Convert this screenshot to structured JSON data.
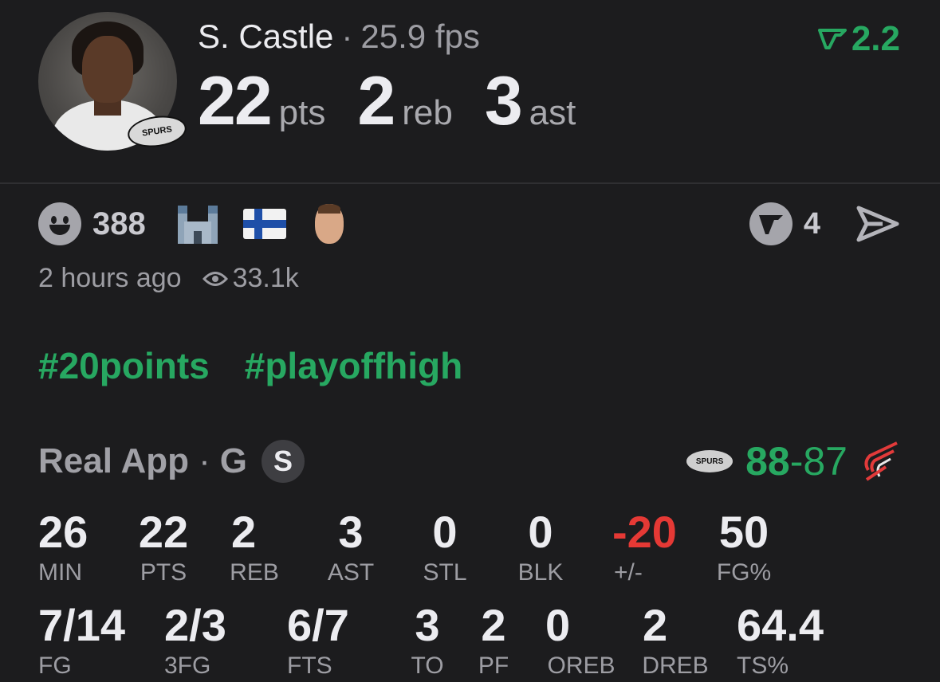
{
  "player": {
    "name": "S. Castle",
    "separator": "·",
    "fps": "25.9 fps",
    "badge_text": "SPURS",
    "stats": [
      {
        "num": "22",
        "unit": "pts"
      },
      {
        "num": "2",
        "unit": "reb"
      },
      {
        "num": "3",
        "unit": "ast"
      }
    ]
  },
  "top_score": {
    "value": "2.2",
    "icon": "real-v-icon",
    "color": "#27a861"
  },
  "reactions": {
    "count": "388",
    "items": [
      "smile-emoji",
      "castle-emoji",
      "finland-flag-emoji",
      "player-face-emoji"
    ]
  },
  "comments": {
    "count": "4",
    "icon": "real-logo-icon",
    "share_icon": "send-icon"
  },
  "meta": {
    "time": "2 hours ago",
    "views": "33.1k"
  },
  "hashtags": [
    "#20points",
    "#playoffhigh"
  ],
  "box": {
    "source": "Real App",
    "separator": "·",
    "position": "G",
    "badge": "S",
    "team_badge_text": "SPURS",
    "home_score": "88",
    "score_sep": "-",
    "away_score": "87",
    "row1": [
      {
        "v": "26",
        "l": "MIN"
      },
      {
        "v": "22",
        "l": "PTS"
      },
      {
        "v": "2",
        "l": "REB"
      },
      {
        "v": "3",
        "l": "AST"
      },
      {
        "v": "0",
        "l": "STL"
      },
      {
        "v": "0",
        "l": "BLK"
      },
      {
        "v": "-20",
        "l": "+/-"
      },
      {
        "v": "50",
        "l": "FG%"
      }
    ],
    "row2": [
      {
        "v": "7/14",
        "l": "FG"
      },
      {
        "v": "2/3",
        "l": "3FG"
      },
      {
        "v": "6/7",
        "l": "FTS"
      },
      {
        "v": "3",
        "l": "TO"
      },
      {
        "v": "2",
        "l": "PF"
      },
      {
        "v": "0",
        "l": "OREB"
      },
      {
        "v": "2",
        "l": "DREB"
      },
      {
        "v": "64.4",
        "l": "TS%"
      }
    ]
  },
  "colors": {
    "accent": "#27a861",
    "negative": "#e53935",
    "background": "#1c1c1e"
  }
}
